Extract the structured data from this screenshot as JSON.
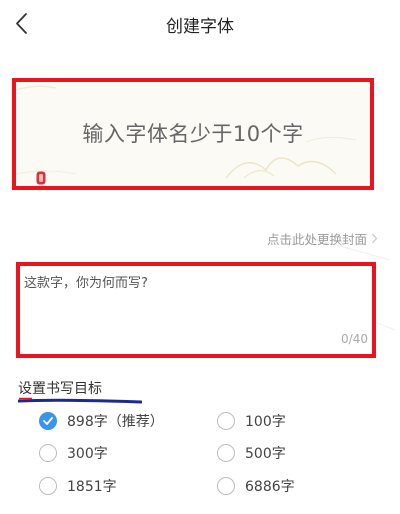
{
  "header": {
    "back_icon": "chevron-left-icon",
    "title": "创建字体"
  },
  "cover": {
    "placeholder": "输入字体名少于10个字",
    "seal_icon": "seal-icon",
    "change_cover_label": "点击此处更换封面",
    "change_cover_icon": "chevron-right-icon"
  },
  "reason": {
    "placeholder": "这款字，你为何而写?",
    "counter": "0/40"
  },
  "goal": {
    "title": "设置书写目标",
    "options": [
      {
        "label": "898字（推荐）",
        "checked": true
      },
      {
        "label": "100字",
        "checked": false
      },
      {
        "label": "300字",
        "checked": false
      },
      {
        "label": "500字",
        "checked": false
      },
      {
        "label": "1851字",
        "checked": false
      },
      {
        "label": "6886字",
        "checked": false
      }
    ]
  },
  "colors": {
    "highlight_red": "#e8141e",
    "radio_checked_blue": "#3b95e8",
    "underline_navy": "#1c2a8f"
  }
}
